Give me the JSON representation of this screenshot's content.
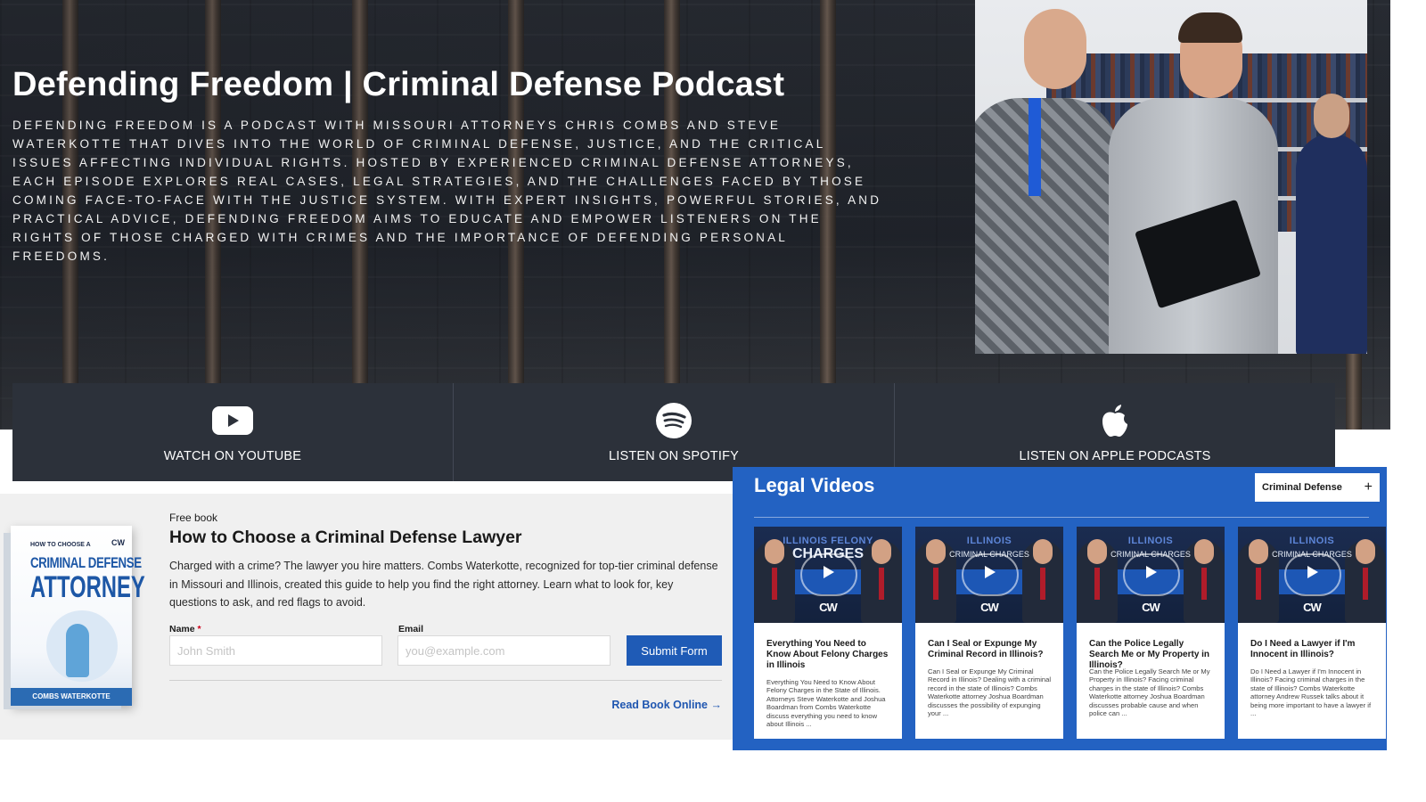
{
  "hero": {
    "title": "Defending Freedom | Criminal Defense Podcast",
    "description": "DEFENDING FREEDOM IS A PODCAST WITH MISSOURI ATTORNEYS CHRIS COMBS AND STEVE WATERKOTTE THAT DIVES INTO THE WORLD OF CRIMINAL DEFENSE, JUSTICE, AND THE CRITICAL ISSUES AFFECTING INDIVIDUAL RIGHTS. HOSTED BY EXPERIENCED CRIMINAL DEFENSE ATTORNEYS, EACH EPISODE EXPLORES REAL CASES, LEGAL STRATEGIES, AND THE CHALLENGES FACED BY THOSE COMING FACE-TO-FACE WITH THE JUSTICE SYSTEM. WITH EXPERT INSIGHTS, POWERFUL STORIES, AND PRACTICAL ADVICE, DEFENDING FREEDOM AIMS TO EDUCATE AND EMPOWER LISTENERS ON THE RIGHTS OF THOSE CHARGED WITH CRIMES AND THE IMPORTANCE OF DEFENDING PERSONAL FREEDOMS."
  },
  "podcast_links": [
    {
      "label": "WATCH ON YOUTUBE",
      "icon": "youtube-icon"
    },
    {
      "label": "LISTEN ON SPOTIFY",
      "icon": "spotify-icon"
    },
    {
      "label": "LISTEN ON APPLE PODCASTS",
      "icon": "apple-icon"
    }
  ],
  "book": {
    "kicker": "Free book",
    "title": "How to Choose a Criminal Defense Lawyer",
    "description": "Charged with a crime? The lawyer you hire matters. Combs Waterkotte, recognized for top-tier criminal defense in Missouri and Illinois, created this guide to help you find the right attorney. Learn what to look for, key questions to ask, and red flags to avoid.",
    "cover": {
      "top": "HOW TO CHOOSE A",
      "brand_mark": "CW",
      "line1": "CRIMINAL DEFENSE",
      "line2": "ATTORNEY",
      "publisher": "COMBS WATERKOTTE"
    },
    "form": {
      "name_label": "Name",
      "name_required": "*",
      "name_placeholder": "John Smith",
      "email_label": "Email",
      "email_placeholder": "you@example.com",
      "submit_label": "Submit Form"
    },
    "read_link": "Read Book Online →"
  },
  "videos": {
    "title": "Legal Videos",
    "category": "Criminal Defense",
    "category_toggle": "+",
    "cards": [
      {
        "thumb_kicker": "ILLINOIS FELONY",
        "thumb_big": "CHARGES",
        "thumb_logo": "CW",
        "title": "Everything You Need to Know About Felony Charges in Illinois",
        "excerpt": "Everything You Need to Know About Felony Charges in the State of Illinois. Attorneys Steve Waterkotte and Joshua Boardman from Combs Waterkotte discuss everything you need to know about Illinois ..."
      },
      {
        "thumb_kicker": "ILLINOIS",
        "thumb_big": "CRIMINAL CHARGES",
        "thumb_logo": "CW",
        "title": "Can I Seal or Expunge My Criminal Record in Illinois?",
        "excerpt": "Can I Seal or Expunge My Criminal Record in Illinois? Dealing with a criminal record in the state of Illinois? Combs Waterkotte attorney Joshua Boardman discusses the possibility of expunging your ..."
      },
      {
        "thumb_kicker": "ILLINOIS",
        "thumb_big": "CRIMINAL CHARGES",
        "thumb_logo": "CW",
        "title": "Can the Police Legally Search Me or My Property in Illinois?",
        "excerpt": "Can the Police Legally Search Me or My Property in Illinois? Facing criminal charges in the state of Illinois? Combs Waterkotte attorney Joshua Boardman discusses probable cause and when police can ..."
      },
      {
        "thumb_kicker": "ILLINOIS",
        "thumb_big": "CRIMINAL CHARGES",
        "thumb_logo": "CW",
        "title": "Do I Need a Lawyer if I'm Innocent in Illinois?",
        "excerpt": "Do I Need a Lawyer if I'm Innocent in Illinois? Facing criminal charges in the state of Illinois? Combs Waterkotte attorney Andrew Russek talks about it being more important to have a lawyer if ..."
      }
    ]
  },
  "colors": {
    "hero_bg": "#22262d",
    "podcast_bar": "#2c313a",
    "accent_blue": "#1f5bb6",
    "videos_bg": "#2362c2",
    "book_bg": "#f0f0f0"
  }
}
